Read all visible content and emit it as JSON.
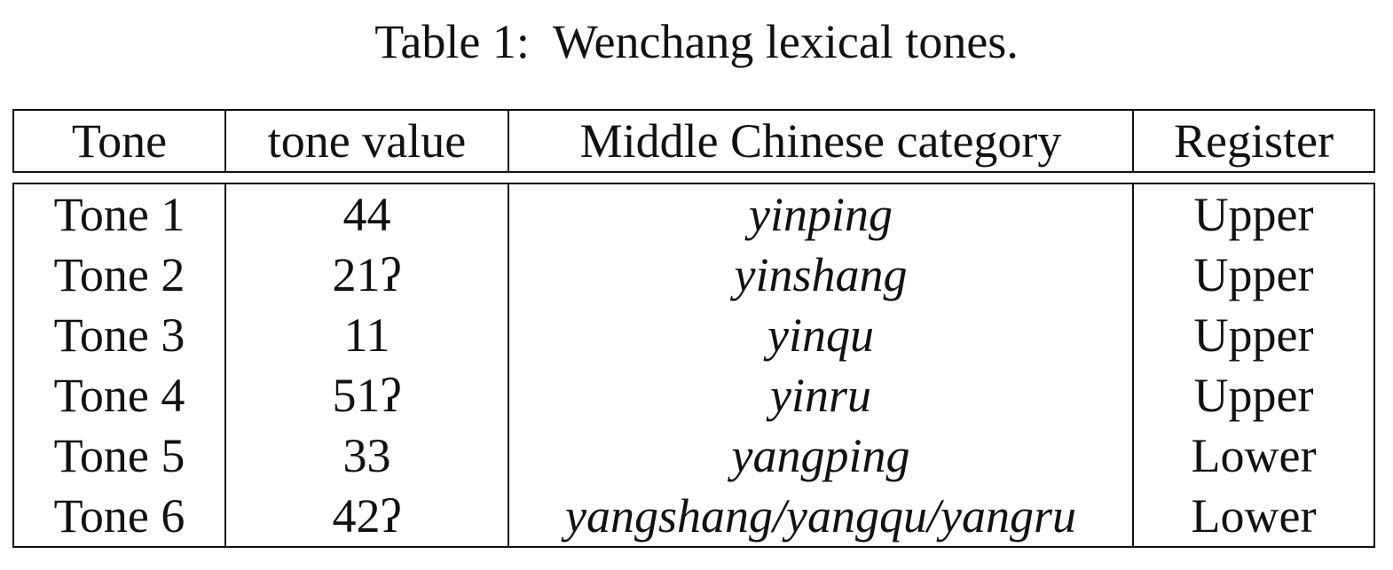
{
  "caption": "Table 1:  Wenchang lexical tones.",
  "table": {
    "headers": [
      "Tone",
      "tone value",
      "Middle Chinese category",
      "Register"
    ],
    "rows": [
      [
        "Tone 1",
        "44",
        "yinping",
        "Upper"
      ],
      [
        "Tone 2",
        "21ʔ",
        "yinshang",
        "Upper"
      ],
      [
        "Tone 3",
        "11",
        "yinqu",
        "Upper"
      ],
      [
        "Tone 4",
        "51ʔ",
        "yinru",
        "Upper"
      ],
      [
        "Tone 5",
        "33",
        "yangping",
        "Lower"
      ],
      [
        "Tone 6",
        "42ʔ",
        "yangshang/yangqu/yangru",
        "Lower"
      ]
    ]
  }
}
